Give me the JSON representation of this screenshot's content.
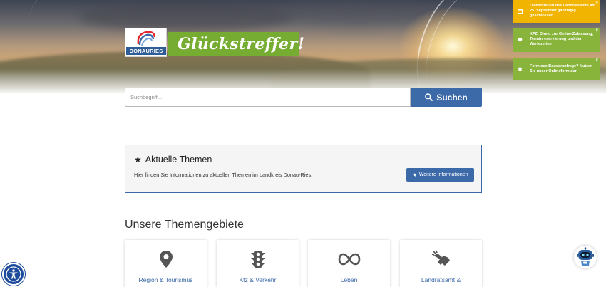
{
  "header": {
    "logo_text": "DONAURIES",
    "slogan": "Glückstreffer!"
  },
  "notices": [
    {
      "icon": "calendar-icon",
      "text": "Dienststellen des Landratsamts am 25. September ganztägig geschlossen",
      "close": "×",
      "color": "#f1b400"
    },
    {
      "icon": "dot-icon",
      "text": "KFZ: Direkt zur Online-Zulassung, Terminreservierung und den Wartezeiten",
      "close": "×",
      "color": "#88b43b"
    },
    {
      "icon": "house-icon",
      "text": "Formlose Bauvoranfrage? Nutzen Sie unser Onlineformular",
      "close": "×",
      "color": "#88b43b"
    }
  ],
  "search": {
    "placeholder": "Suchbegriff...",
    "value": "",
    "button_label": "Suchen"
  },
  "aktuelle_themen": {
    "title": "Aktuelle Themen",
    "description": "Hier finden Sie Informationen zu aktuellen Themen im Landkreis Donau-Ries.",
    "button_label": "Weitere Informationen"
  },
  "themengebiete": {
    "title": "Unsere Themengebiete",
    "cards": [
      {
        "label": "Region & Tourismus",
        "icon": "map-pin-icon"
      },
      {
        "label": "Kfz & Verkehr",
        "icon": "traffic-light-icon"
      },
      {
        "label": "Leben",
        "icon": "infinity-icon"
      },
      {
        "label": "Landratsamt &",
        "icon": "handshake-icon"
      }
    ]
  },
  "colors": {
    "primary": "#3c6aa8",
    "green": "#77ac32",
    "yellow": "#f1b400",
    "a11y_blue": "#1e4b9b"
  },
  "accessibility_icon": "accessibility-icon",
  "chatbot_icon": "robot-icon"
}
